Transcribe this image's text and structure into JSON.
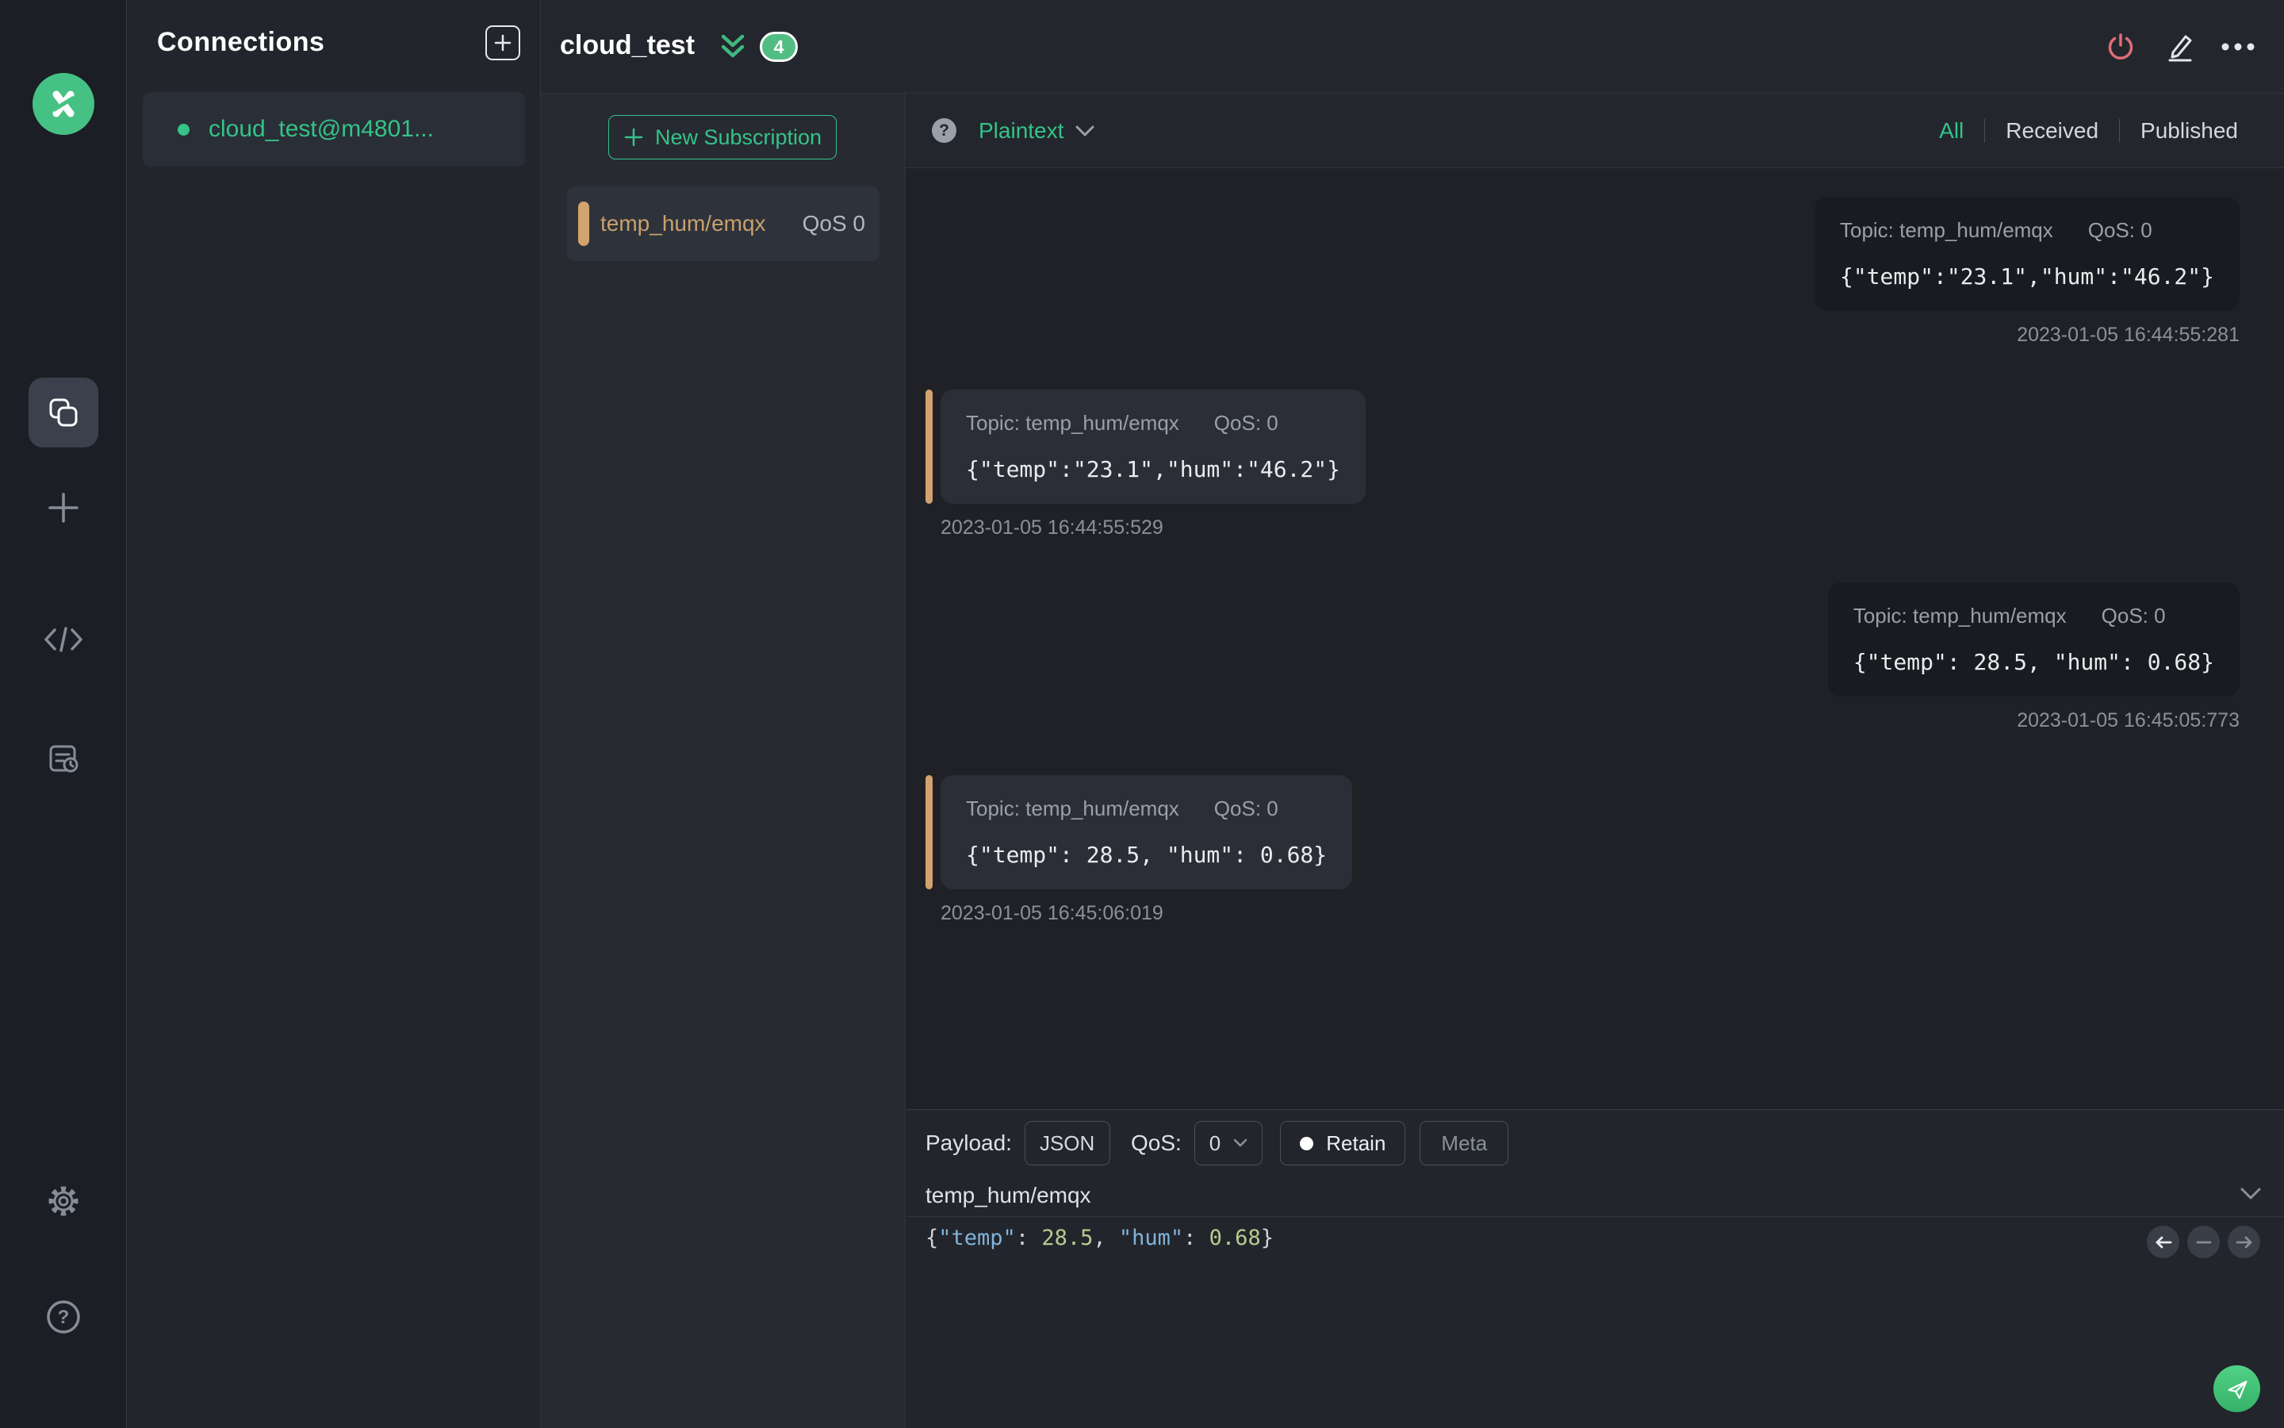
{
  "colors": {
    "accent_green": "#34c388",
    "logo_green": "#45c184",
    "topic_accent": "#d2a36e",
    "power_red": "#e06c75",
    "key_blue": "#82b4da",
    "number_green": "#b5cc8e"
  },
  "sidebar": {
    "icons": [
      "mqttx-logo",
      "connections",
      "new-window",
      "script",
      "log",
      "settings",
      "help"
    ]
  },
  "connections": {
    "title": "Connections",
    "items": [
      {
        "name": "cloud_test@m4801..."
      }
    ]
  },
  "header": {
    "title": "cloud_test",
    "badge_count": "4"
  },
  "filter_bar": {
    "help": "?",
    "format_selected": "Plaintext",
    "tabs": [
      {
        "label": "All",
        "active": true
      },
      {
        "label": "Received",
        "active": false
      },
      {
        "label": "Published",
        "active": false
      }
    ]
  },
  "subscriptions": {
    "new_subscription_label": "New Subscription",
    "items": [
      {
        "topic": "temp_hum/emqx",
        "qos": "QoS 0"
      }
    ]
  },
  "messages": [
    {
      "direction": "published",
      "topic_label": "Topic: temp_hum/emqx",
      "qos_label": "QoS: 0",
      "payload": "{\"temp\":\"23.1\",\"hum\":\"46.2\"}",
      "timestamp": "2023-01-05 16:44:55:281"
    },
    {
      "direction": "received",
      "topic_label": "Topic: temp_hum/emqx",
      "qos_label": "QoS: 0",
      "payload": "{\"temp\":\"23.1\",\"hum\":\"46.2\"}",
      "timestamp": "2023-01-05 16:44:55:529"
    },
    {
      "direction": "published",
      "topic_label": "Topic: temp_hum/emqx",
      "qos_label": "QoS: 0",
      "payload": "{\"temp\": 28.5, \"hum\": 0.68}",
      "timestamp": "2023-01-05 16:45:05:773"
    },
    {
      "direction": "received",
      "topic_label": "Topic: temp_hum/emqx",
      "qos_label": "QoS: 0",
      "payload": "{\"temp\": 28.5, \"hum\": 0.68}",
      "timestamp": "2023-01-05 16:45:06:019"
    }
  ],
  "publish": {
    "payload_label": "Payload:",
    "payload_format": "JSON",
    "qos_label": "QoS:",
    "qos_value": "0",
    "retain_label": "Retain",
    "meta_label": "Meta",
    "topic_value": "temp_hum/emqx",
    "payload_segments": [
      {
        "text": "{",
        "type": "punct"
      },
      {
        "text": "\"temp\"",
        "type": "key"
      },
      {
        "text": ": ",
        "type": "punct"
      },
      {
        "text": "28.5",
        "type": "number"
      },
      {
        "text": ", ",
        "type": "punct"
      },
      {
        "text": "\"hum\"",
        "type": "key"
      },
      {
        "text": ": ",
        "type": "punct"
      },
      {
        "text": "0.68",
        "type": "number"
      },
      {
        "text": "}",
        "type": "punct"
      }
    ]
  }
}
